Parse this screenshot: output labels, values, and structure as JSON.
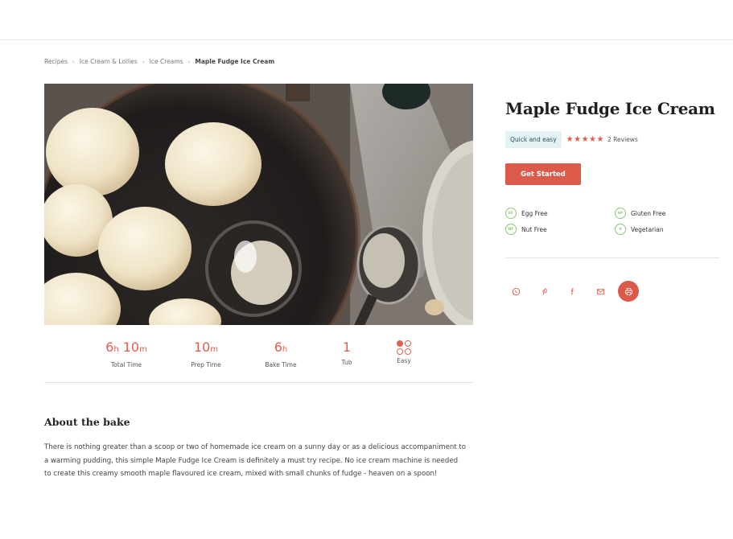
{
  "breadcrumb": {
    "items": [
      "Recipes",
      "Ice Cream & Lollies",
      "Ice Creams"
    ],
    "current": "Maple Fudge Ice Cream",
    "separator": "›"
  },
  "recipe": {
    "title": "Maple Fudge Ice Cream",
    "tag": "Quick and easy",
    "rating": 5,
    "stars": "★★★★★",
    "reviews": "2 Reviews",
    "cta": "Get Started"
  },
  "dietary": [
    {
      "code": "EF",
      "label": "Egg Free"
    },
    {
      "code": "GF",
      "label": "Gluten Free"
    },
    {
      "code": "NF",
      "label": "Nut Free"
    },
    {
      "code": "V",
      "label": "Vegetarian"
    }
  ],
  "stats": [
    {
      "label": "Total Time"
    },
    {
      "label": "Prep Time"
    },
    {
      "label": "Bake Time"
    },
    {
      "value": "1",
      "label": "Tub"
    },
    {
      "label": "Easy"
    }
  ],
  "stat_values": {
    "total_h": "6",
    "total_h_unit": "h",
    "total_m": "10",
    "total_m_unit": "m",
    "prep_m": "10",
    "prep_m_unit": "m",
    "bake_h": "6",
    "bake_h_unit": "h"
  },
  "about": {
    "title": "About the bake",
    "text": "There is nothing greater than a scoop or two of homemade ice cream on a sunny day or as a delicious accompaniment to a warming pudding, this simple Maple Fudge Ice Cream is definitely a must try recipe. No ice cream machine is needed to create this creamy smooth maple flavoured ice cream, mixed with small chunks of fudge - heaven on a spoon!"
  },
  "share": [
    "whatsapp-icon",
    "pinterest-icon",
    "facebook-icon",
    "email-icon",
    "print-icon"
  ],
  "colors": {
    "accent": "#dc5a49",
    "diet_badge": "#8cc77a",
    "tag_bg": "#e3f3f3"
  }
}
